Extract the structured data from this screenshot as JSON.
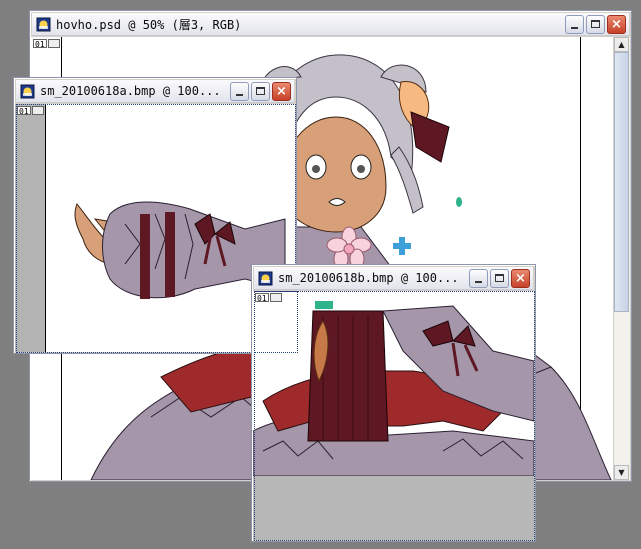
{
  "windows": {
    "main": {
      "title": "hovho.psd @ 50% (層3, RGB)",
      "layer_number": "01"
    },
    "a": {
      "title": "sm_20100618a.bmp @ 100...",
      "layer_number": "01"
    },
    "b": {
      "title": "sm_20100618b.bmp @ 100...",
      "layer_number": "01"
    }
  },
  "buttons": {
    "minimize": "minimize",
    "maximize": "maximize",
    "close": "×"
  },
  "scrollbar": {
    "up_arrow": "▲",
    "down_arrow": "▼"
  },
  "colors": {
    "workspace": "#7f7f7f",
    "hair": "#c4c0ca",
    "skin": "#d7a078",
    "sleeve": "#a596aa",
    "ribbon": "#5e1823",
    "skirt": "#9e2a2c",
    "horn": "#f6b982"
  }
}
